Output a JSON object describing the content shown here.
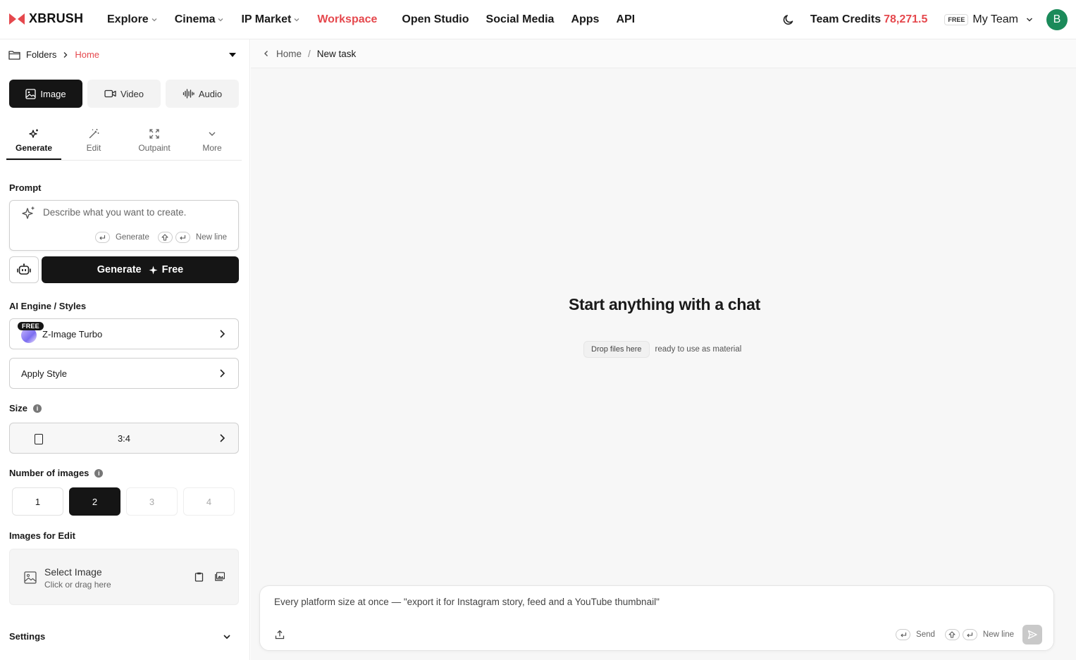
{
  "brand": {
    "name": "XBRUSH",
    "color": "#e5484d"
  },
  "nav": {
    "explore": "Explore",
    "cinema": "Cinema",
    "ip_market": "IP Market",
    "workspace": "Workspace",
    "open_studio": "Open Studio",
    "social_media": "Social Media",
    "apps": "Apps",
    "api": "API"
  },
  "header": {
    "credits_label": "Team Credits",
    "credits_value": "78,271.5",
    "plan_badge": "FREE",
    "team_name": "My Team",
    "avatar_initial": "B"
  },
  "sidebar": {
    "breadcrumb": {
      "folders": "Folders",
      "home": "Home"
    },
    "media_tabs": {
      "image": "Image",
      "video": "Video",
      "audio": "Audio"
    },
    "tool_tabs": {
      "generate": "Generate",
      "edit": "Edit",
      "outpaint": "Outpaint",
      "more": "More"
    },
    "prompt": {
      "label": "Prompt",
      "placeholder": "Describe what you want to create.",
      "hint_generate": "Generate",
      "hint_newline": "New line"
    },
    "generate_button": {
      "label": "Generate",
      "cost": "Free"
    },
    "engine": {
      "label": "AI Engine / Styles",
      "free_tag": "FREE",
      "model": "Z-Image Turbo",
      "apply_style": "Apply Style"
    },
    "size": {
      "label": "Size",
      "info": "i",
      "value": "3:4"
    },
    "num_images": {
      "label": "Number of images",
      "info": "i",
      "options": [
        "1",
        "2",
        "3",
        "4"
      ],
      "selected": "2"
    },
    "images_for_edit": {
      "label": "Images for Edit",
      "select": "Select Image",
      "sub": "Click or drag here"
    },
    "settings": {
      "label": "Settings"
    }
  },
  "main": {
    "breadcrumb": {
      "home": "Home",
      "sep": "/",
      "current": "New task"
    },
    "hero": "Start anything with a chat",
    "drop_chip": "Drop files here",
    "drop_text": "ready to use as material",
    "chat": {
      "placeholder": "Every platform size at once — \"export it for Instagram story, feed and a YouTube thumbnail\"",
      "hint_send": "Send",
      "hint_newline": "New line"
    }
  },
  "icons": [
    "logo-icon",
    "moon-icon",
    "folder-icon",
    "chevron-right-icon",
    "caret-down-icon",
    "image-icon",
    "video-icon",
    "audio-icon",
    "sparkle-icon",
    "magic-wand-icon",
    "expand-icon",
    "chevron-down-icon",
    "enter-key-icon",
    "shift-key-icon",
    "robot-icon",
    "info-icon",
    "clipboard-icon",
    "gallery-icon",
    "upload-icon",
    "send-icon",
    "chevron-left-icon"
  ]
}
